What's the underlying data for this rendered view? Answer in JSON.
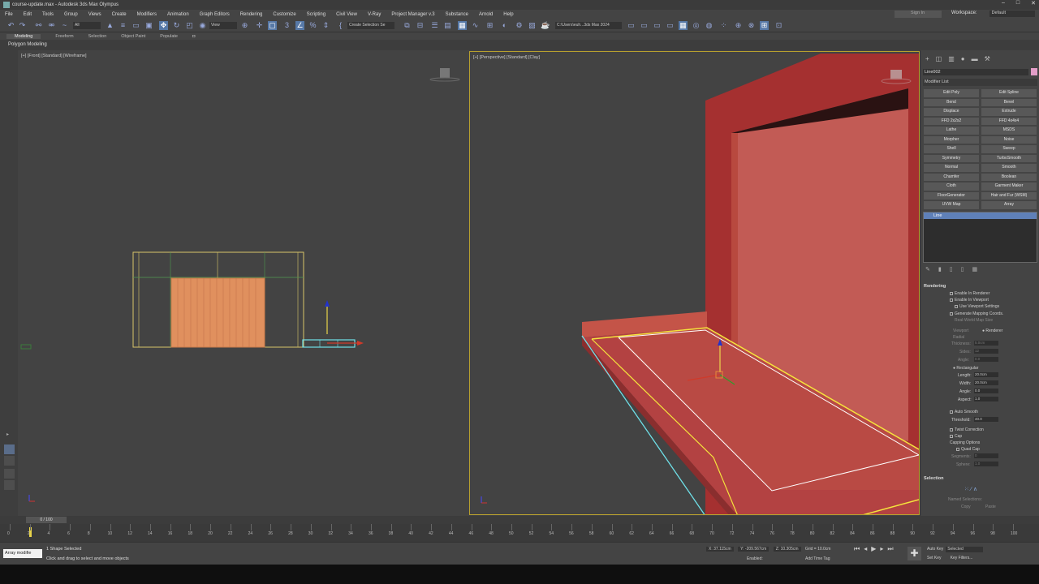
{
  "window": {
    "title": "course-update.max - Autodesk 3ds Max Olympus",
    "controls": [
      "–",
      "□",
      "✕"
    ]
  },
  "menu": {
    "items": [
      "File",
      "Edit",
      "Tools",
      "Group",
      "Views",
      "Create",
      "Modifiers",
      "Animation",
      "Graph Editors",
      "Rendering",
      "Customize",
      "Scripting",
      "Civil View",
      "V-Ray",
      "Project Manager v.3",
      "Substance",
      "Arnold",
      "Help"
    ],
    "signin": "Sign In",
    "workspace_label": "Workspace:",
    "workspace_value": "Default"
  },
  "toolbar": {
    "filter": "All",
    "refcoord": "View",
    "selection_set": "Create Selection Se",
    "path": "C:\\Users\\euh...3ds Max 2024"
  },
  "ribbon": {
    "tabs": [
      "Modeling",
      "Freeform",
      "Selection",
      "Object Paint",
      "Populate"
    ],
    "active": "Modeling",
    "sub": "Polygon Modeling"
  },
  "viewports": {
    "front": {
      "label": "[+] [Front] [Standard] [Wireframe]"
    },
    "persp": {
      "label": "[+] [Perspective] [Standard] [Clay]"
    }
  },
  "cmd": {
    "object_name": "Line002",
    "modifier_list": "Modifier List",
    "mod_left": [
      "Edit Poly",
      "Bend",
      "Displace",
      "FFD 2x2x2",
      "Lathe",
      "Morpher",
      "Shell",
      "Symmetry",
      "Normal",
      "Chamfer",
      "Cloth",
      "FloorGenerator",
      "UVW Map"
    ],
    "mod_right": [
      "Edit Spline",
      "Bevel",
      "Extrude",
      "FFD 4x4x4",
      "MSDS",
      "Noise",
      "Sweep",
      "TurboSmooth",
      "Smooth",
      "Boolean",
      "Garment Maker",
      "Hair and Fur (WSM)",
      "Array"
    ],
    "stack_item": "Line",
    "rendering": {
      "title": "Rendering",
      "enable_renderer": "Enable In Renderer",
      "enable_viewport": "Enable In Viewport",
      "use_viewport": "Use Viewport Settings",
      "gen_mapping": "Generate Mapping Coords.",
      "real_world": "Real-World Map Size",
      "viewport": "Viewport",
      "renderer": "Renderer",
      "radial": "Radial",
      "thickness": "Thickness:",
      "thickness_val": "5.0cm",
      "sides": "Sides:",
      "sides_val": "12",
      "angle": "Angle:",
      "angle_val": "0.0",
      "rectangular": "Rectangular",
      "length": "Length:",
      "length_val": "20.0cm",
      "width": "Width:",
      "width_val": "20.0cm",
      "angle2": "Angle:",
      "angle2_val": "0.0",
      "aspect": "Aspect:",
      "aspect_val": "1.0",
      "auto_smooth": "Auto Smooth",
      "threshold": "Threshold:",
      "threshold_val": "40.0",
      "twist": "Twist Correction",
      "cap": "Cap",
      "capping": "Capping Options",
      "quad_cap": "Quad Cap",
      "segments": "Segments:",
      "segments_val": "0",
      "sphere": "Sphere:",
      "sphere_val": "1.0"
    },
    "selection": {
      "title": "Selection",
      "named": "Named Selections:",
      "copy": "Copy",
      "paste": "Paste"
    }
  },
  "timeline": {
    "frame_box": "0 / 100",
    "ticks": [
      "0",
      "2",
      "4",
      "6",
      "8",
      "10",
      "12",
      "14",
      "16",
      "18",
      "20",
      "22",
      "24",
      "26",
      "28",
      "30",
      "32",
      "34",
      "36",
      "38",
      "40",
      "42",
      "44",
      "46",
      "48",
      "50",
      "52",
      "54",
      "56",
      "58",
      "60",
      "62",
      "64",
      "66",
      "68",
      "70",
      "72",
      "74",
      "76",
      "78",
      "80",
      "82",
      "84",
      "86",
      "88",
      "90",
      "92",
      "94",
      "96",
      "98",
      "100"
    ]
  },
  "status": {
    "maxscript": "Array modifie",
    "selected": "1 Shape Selected",
    "hint": "Click and drag to select and move objects",
    "x": "X: 37.115cm",
    "y": "Y: -209.567cm",
    "z": "Z: 10.305cm",
    "grid": "Grid = 10.0cm",
    "enabled": "Enabled:",
    "add_time_tag": "Add Time Tag",
    "auto_key": "Auto Key",
    "auto_key_val": "Selected",
    "set_key": "Set Key",
    "key_filters": "Key Filters..."
  }
}
